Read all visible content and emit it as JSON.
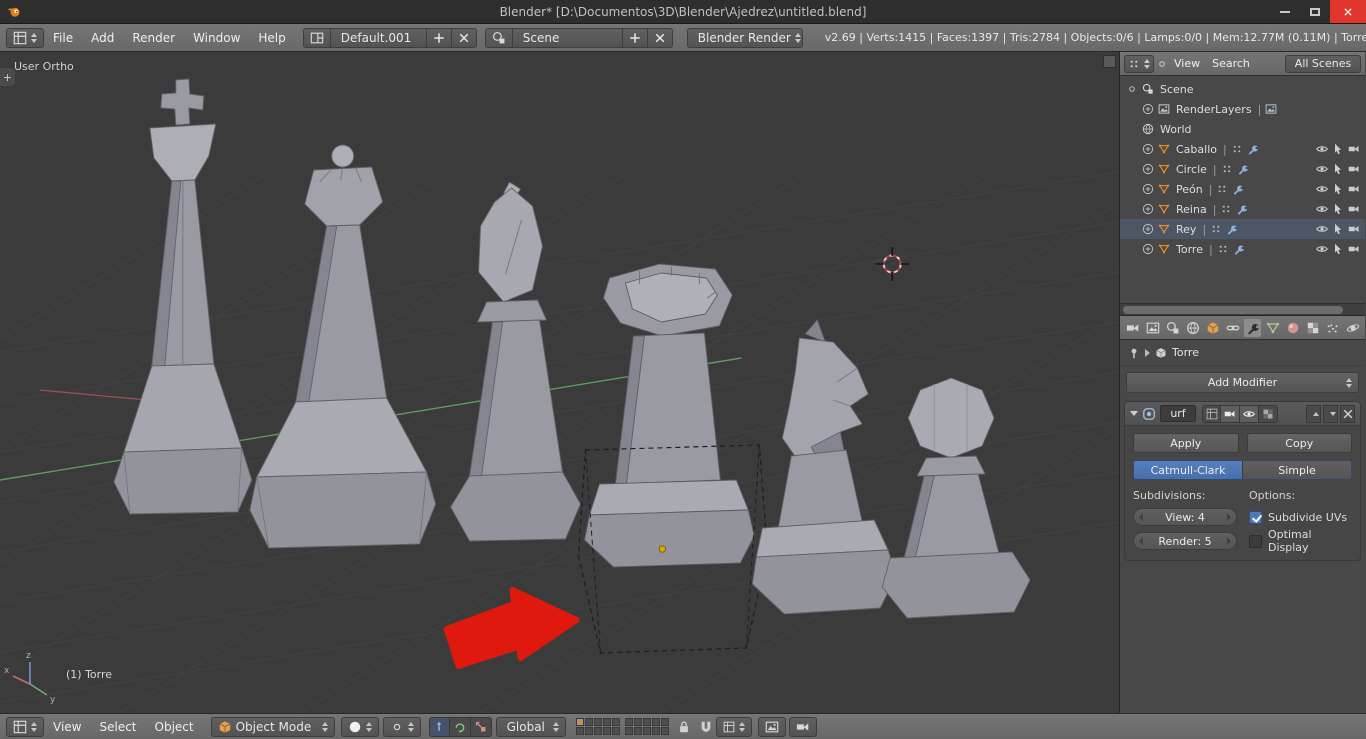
{
  "colors": {
    "accent_blue": "#4d79b8",
    "object_orange": "#e58926",
    "arrow_red": "#e0190f",
    "close_red": "#e0362c"
  },
  "titlebar": {
    "title": "Blender* [D:\\Documentos\\3D\\Blender\\Ajedrez\\untitled.blend]"
  },
  "top_header": {
    "menus": [
      "File",
      "Add",
      "Render",
      "Window",
      "Help"
    ],
    "layout": "Default.001",
    "scene": "Scene",
    "engine": "Blender Render",
    "stats": "v2.69 | Verts:1415 | Faces:1397 | Tris:2784 | Objects:0/6 | Lamps:0/0 | Mem:12.77M (0.11M) | Torre"
  },
  "viewport": {
    "view_label": "User Ortho",
    "active_object": "(1) Torre",
    "axis": {
      "x": "x",
      "y": "y",
      "z": "z"
    }
  },
  "outliner": {
    "header": {
      "view": "View",
      "search": "Search",
      "scope": "All Scenes"
    },
    "scene": "Scene",
    "renderlayers": "RenderLayers",
    "world": "World",
    "separator": "|",
    "objects": [
      {
        "name": "Caballo"
      },
      {
        "name": "Circle"
      },
      {
        "name": "Peón"
      },
      {
        "name": "Reina"
      },
      {
        "name": "Rey"
      },
      {
        "name": "Torre"
      }
    ]
  },
  "properties": {
    "context": "Torre",
    "add_modifier": "Add Modifier",
    "modifier": {
      "name": "urf",
      "apply": "Apply",
      "copy": "Copy",
      "type_a": "Catmull-Clark",
      "type_b": "Simple",
      "subdivisions": "Subdivisions:",
      "options": "Options:",
      "view": "View: 4",
      "render": "Render: 5",
      "subdivide_uvs": "Subdivide UVs",
      "optimal_display": "Optimal Display"
    }
  },
  "bottom": {
    "menus": [
      "View",
      "Select",
      "Object"
    ],
    "mode": "Object Mode",
    "orientation": "Global"
  }
}
